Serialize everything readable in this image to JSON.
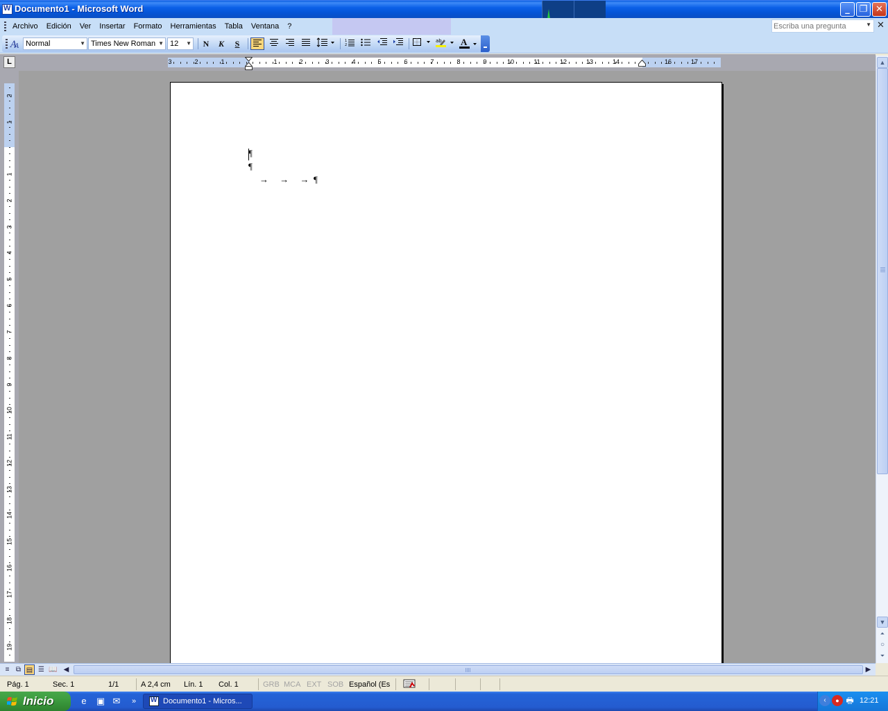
{
  "window": {
    "title": "Documento1 - Microsoft Word",
    "controls": {
      "minimize": "_",
      "maximize": "❐",
      "close": "✕"
    }
  },
  "menu": {
    "items": [
      "Archivo",
      "Edición",
      "Ver",
      "Insertar",
      "Formato",
      "Herramientas",
      "Tabla",
      "Ventana",
      "?"
    ],
    "help_placeholder": "Escriba una pregunta",
    "close_doc": "✕"
  },
  "toolbar": {
    "style": "Normal",
    "font": "Times New Roman",
    "size": "12",
    "bold": "N",
    "italic": "K",
    "underline": "S",
    "font_color": "A",
    "pressed_button": "align-left"
  },
  "ruler": {
    "tab_selector": "L",
    "horizontal_numbers": [
      "3",
      "2",
      "1",
      "1",
      "2",
      "3",
      "4",
      "5",
      "6",
      "7",
      "8",
      "9",
      "10",
      "11",
      "12",
      "13",
      "14",
      "16",
      "17"
    ],
    "vertical_numbers": [
      "2",
      "1",
      "1",
      "2",
      "3",
      "4",
      "5",
      "6",
      "7",
      "8",
      "9",
      "10",
      "11",
      "12",
      "13",
      "14",
      "15",
      "16",
      "17",
      "18",
      "19"
    ]
  },
  "document": {
    "lines": [
      "¶",
      "¶",
      "→     →     →  ¶"
    ]
  },
  "statusbar": {
    "page": "Pág. 1",
    "section": "Sec. 1",
    "page_count": "1/1",
    "at": "A  2,4 cm",
    "line": "Lín. 1",
    "column": "Col. 1",
    "modes": [
      "GRB",
      "MCA",
      "EXT",
      "SOB"
    ],
    "language": "Español (Es"
  },
  "taskbar": {
    "start_label": "Inicio",
    "task_label": "Documento1 - Micros...",
    "overflow": "»",
    "clock": "12:21"
  },
  "colors": {
    "titlebar": "#0b60e7",
    "menubar": "#c7def7",
    "document_bg": "#a0a0a0",
    "page": "#ffffff",
    "taskbar": "#245cd0",
    "start_button": "#3d9d3f"
  }
}
